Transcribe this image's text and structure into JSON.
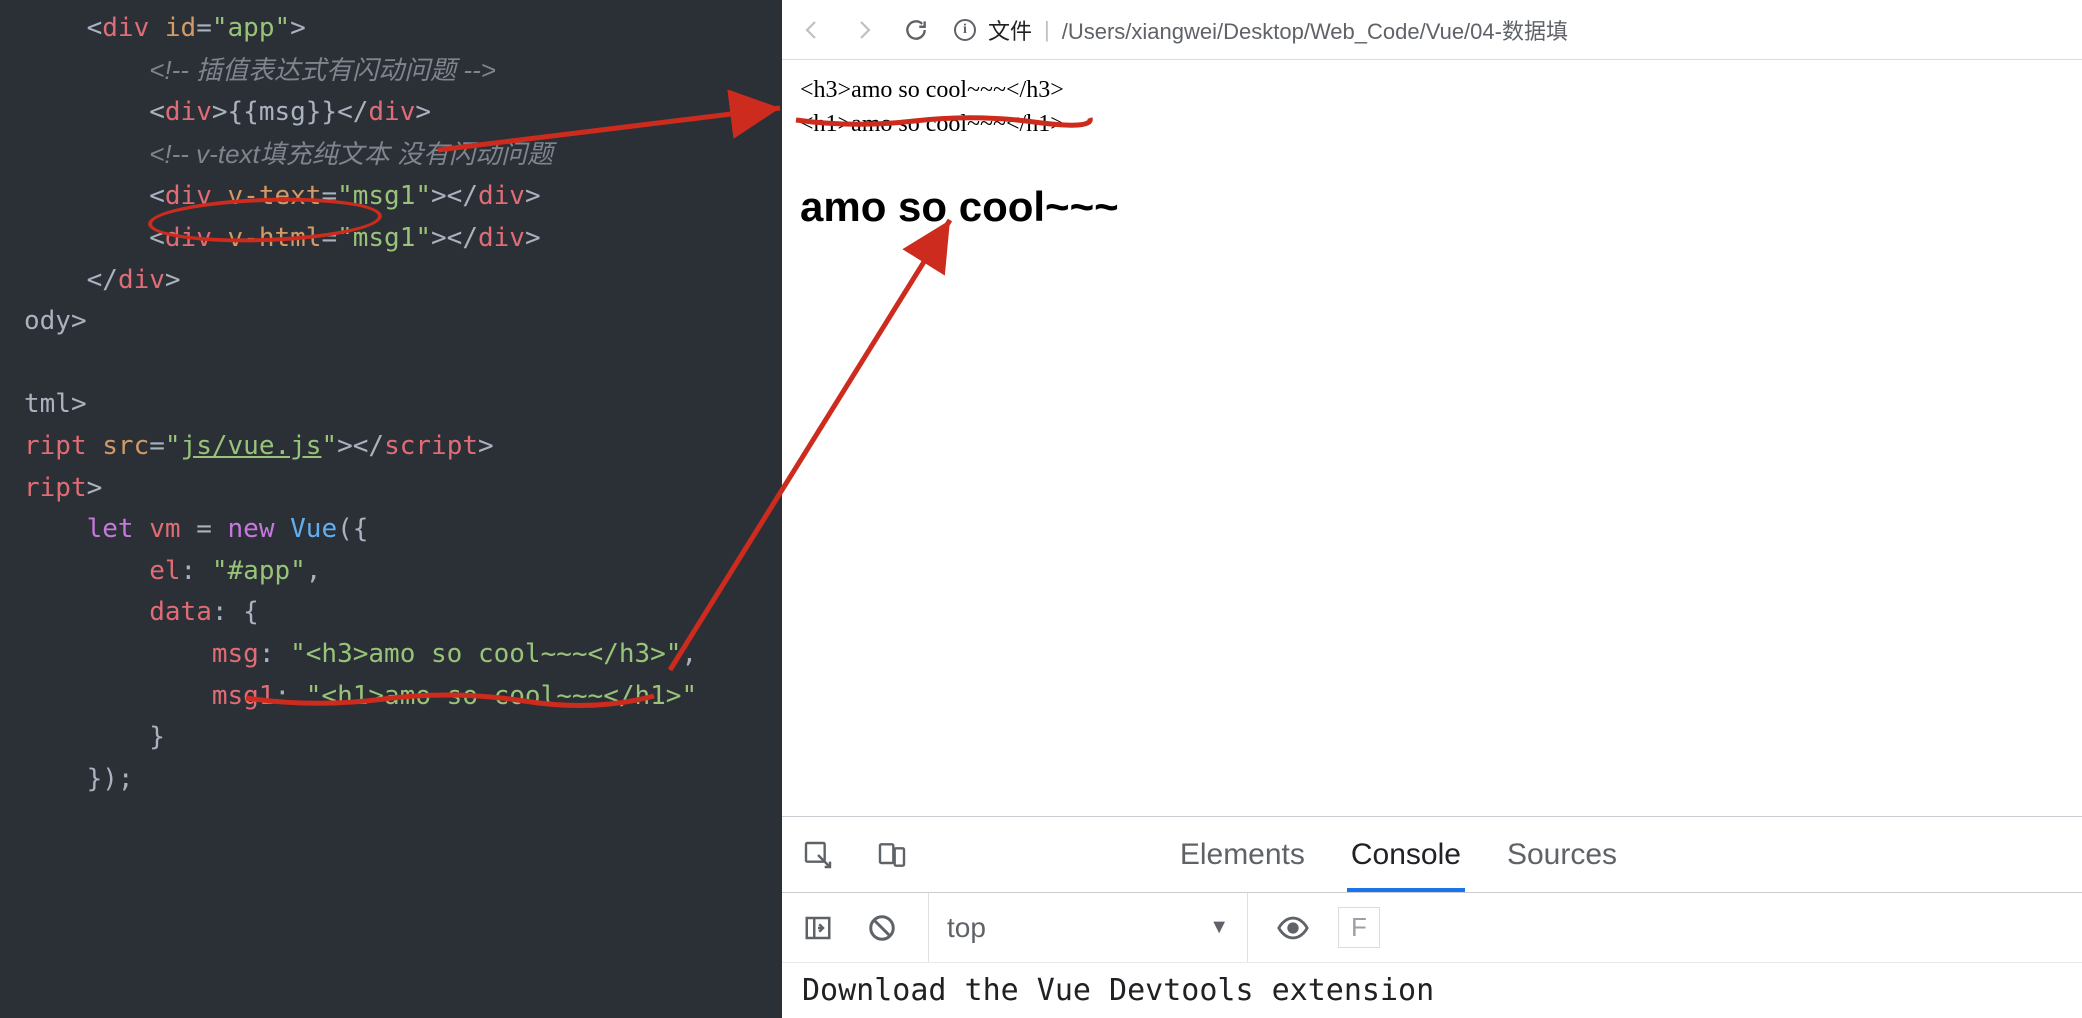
{
  "editor": {
    "lines": [
      {
        "indent": 1,
        "tokens": [
          {
            "t": "punct",
            "v": "<"
          },
          {
            "t": "tag",
            "v": "div"
          },
          {
            "t": "punct",
            "v": " "
          },
          {
            "t": "attr",
            "v": "id"
          },
          {
            "t": "punct",
            "v": "="
          },
          {
            "t": "str",
            "v": "\"app\""
          },
          {
            "t": "punct",
            "v": ">"
          }
        ]
      },
      {
        "indent": 2,
        "tokens": [
          {
            "t": "comment",
            "v": "<!-- 插值表达式有闪动问题 -->"
          }
        ]
      },
      {
        "indent": 2,
        "tokens": [
          {
            "t": "punct",
            "v": "<"
          },
          {
            "t": "tag",
            "v": "div"
          },
          {
            "t": "punct",
            "v": ">{{msg}}</"
          },
          {
            "t": "tag",
            "v": "div"
          },
          {
            "t": "punct",
            "v": ">"
          }
        ]
      },
      {
        "indent": 2,
        "tokens": [
          {
            "t": "comment",
            "v": "<!-- v-text填充纯文本 没有闪动问题"
          }
        ]
      },
      {
        "indent": 2,
        "tokens": [
          {
            "t": "punct",
            "v": "<"
          },
          {
            "t": "tag",
            "v": "div"
          },
          {
            "t": "punct",
            "v": " "
          },
          {
            "t": "attr",
            "v": "v-text"
          },
          {
            "t": "punct",
            "v": "="
          },
          {
            "t": "str",
            "v": "\"msg1\""
          },
          {
            "t": "punct",
            "v": "></"
          },
          {
            "t": "tag",
            "v": "div"
          },
          {
            "t": "punct",
            "v": ">"
          }
        ]
      },
      {
        "indent": 2,
        "tokens": [
          {
            "t": "punct",
            "v": "<"
          },
          {
            "t": "tag",
            "v": "div"
          },
          {
            "t": "punct",
            "v": " "
          },
          {
            "t": "attr",
            "v": "v-html"
          },
          {
            "t": "punct",
            "v": "="
          },
          {
            "t": "str",
            "v": "\"msg1\""
          },
          {
            "t": "punct",
            "v": "></"
          },
          {
            "t": "tag",
            "v": "div"
          },
          {
            "t": "punct",
            "v": ">"
          }
        ]
      },
      {
        "indent": 1,
        "tokens": [
          {
            "t": "punct",
            "v": "</"
          },
          {
            "t": "tag",
            "v": "div"
          },
          {
            "t": "punct",
            "v": ">"
          }
        ]
      },
      {
        "indent": 0,
        "tokens": [
          {
            "t": "punct",
            "v": "ody>"
          }
        ]
      },
      {
        "indent": 0,
        "tokens": [
          {
            "t": "punct",
            "v": ""
          }
        ]
      },
      {
        "indent": 0,
        "tokens": [
          {
            "t": "punct",
            "v": "tml>"
          }
        ]
      },
      {
        "indent": 0,
        "tokens": [
          {
            "t": "tag",
            "v": "ript"
          },
          {
            "t": "punct",
            "v": " "
          },
          {
            "t": "attr",
            "v": "src"
          },
          {
            "t": "punct",
            "v": "="
          },
          {
            "t": "str",
            "v": "\""
          },
          {
            "t": "str underline",
            "v": "js/vue.js"
          },
          {
            "t": "str",
            "v": "\""
          },
          {
            "t": "punct",
            "v": "></"
          },
          {
            "t": "tag",
            "v": "script"
          },
          {
            "t": "punct",
            "v": ">"
          }
        ]
      },
      {
        "indent": 0,
        "tokens": [
          {
            "t": "tag",
            "v": "ript"
          },
          {
            "t": "punct",
            "v": ">"
          }
        ]
      },
      {
        "indent": 1,
        "tokens": [
          {
            "t": "kw",
            "v": "let"
          },
          {
            "t": "punct",
            "v": " "
          },
          {
            "t": "varname",
            "v": "vm"
          },
          {
            "t": "punct",
            "v": " = "
          },
          {
            "t": "kw",
            "v": "new"
          },
          {
            "t": "punct",
            "v": " "
          },
          {
            "t": "func",
            "v": "Vue"
          },
          {
            "t": "punct",
            "v": "({"
          }
        ]
      },
      {
        "indent": 2,
        "tokens": [
          {
            "t": "prop",
            "v": "el"
          },
          {
            "t": "punct",
            "v": ": "
          },
          {
            "t": "str",
            "v": "\"#app\""
          },
          {
            "t": "punct",
            "v": ","
          }
        ]
      },
      {
        "indent": 2,
        "tokens": [
          {
            "t": "prop",
            "v": "data"
          },
          {
            "t": "punct",
            "v": ": {"
          }
        ]
      },
      {
        "indent": 3,
        "tokens": [
          {
            "t": "prop",
            "v": "msg"
          },
          {
            "t": "punct",
            "v": ": "
          },
          {
            "t": "str",
            "v": "\"<h3>amo so cool~~~</h3>\""
          },
          {
            "t": "punct",
            "v": ","
          }
        ]
      },
      {
        "indent": 3,
        "tokens": [
          {
            "t": "prop",
            "v": "msg1"
          },
          {
            "t": "punct",
            "v": ": "
          },
          {
            "t": "str",
            "v": "\"<h1>amo so cool~~~</h1>\""
          }
        ]
      },
      {
        "indent": 2,
        "tokens": [
          {
            "t": "punct",
            "v": "}"
          }
        ]
      },
      {
        "indent": 1,
        "tokens": [
          {
            "t": "punct",
            "v": "});"
          }
        ]
      }
    ]
  },
  "browser": {
    "addr_prefix": "文件",
    "addr_path": "/Users/xiangwei/Desktop/Web_Code/Vue/04-数据填",
    "output_line1": "<h3>amo so cool~~~</h3>",
    "output_line2": "<h1>amo so cool~~~</h1>",
    "output_heading": "amo so cool~~~"
  },
  "devtools": {
    "tabs": {
      "elements": "Elements",
      "console": "Console",
      "sources": "Sources"
    },
    "context": "top",
    "filter_placeholder": "F",
    "message": "Download the Vue Devtools extension"
  }
}
